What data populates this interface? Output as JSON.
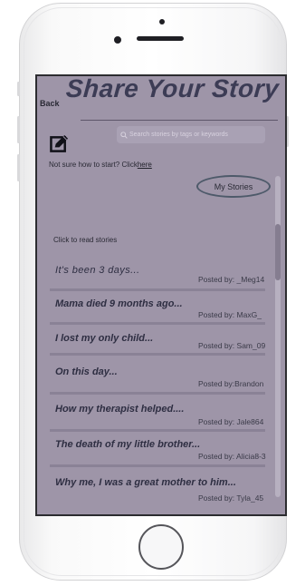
{
  "app": {
    "back_label": "Back",
    "title": "Share Your Story",
    "search": {
      "placeholder": "Search stories by tags or keywords"
    },
    "hint_text": "Not sure how to start? Click",
    "hint_link": "here",
    "my_stories_label": "My Stories",
    "click_to_read": "Click to read stories"
  },
  "stories": [
    {
      "title": "It's been 3 days...",
      "posted_by": "Posted by: _Meg14"
    },
    {
      "title": "Mama died 9 months ago...",
      "posted_by": "Posted by: MaxG_"
    },
    {
      "title": "I lost my only child...",
      "posted_by": "Posted by: Sam_09"
    },
    {
      "title": "On this day...",
      "posted_by": "Posted by:Brandon"
    },
    {
      "title": "How my therapist helped....",
      "posted_by": "Posted by: Jale864"
    },
    {
      "title": "The death of my little brother...",
      "posted_by": "Posted by: Alicia8-3"
    },
    {
      "title": "Why me, I was a great mother to him...",
      "posted_by": "Posted by: Tyla_45"
    }
  ],
  "colors": {
    "screen_bg": "#9e95a8",
    "title": "#3c3c55",
    "text": "#2a2a35"
  }
}
